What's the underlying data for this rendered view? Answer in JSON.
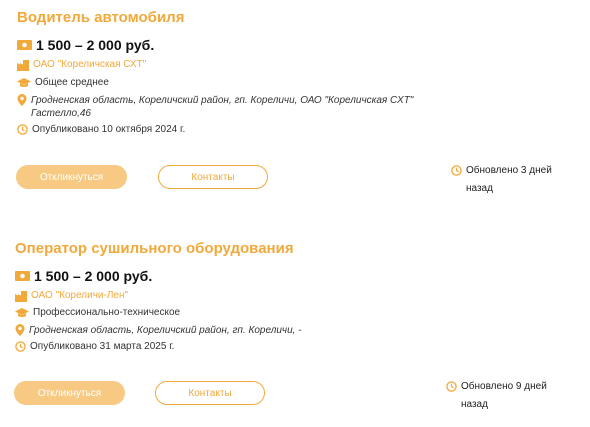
{
  "vacancies": [
    {
      "title": "Водитель автомобиля",
      "salary": "1 500 – 2 000 руб.",
      "company": "ОАО \"Кореличская СХТ\"",
      "education": "Общее среднее",
      "address_line1": "Гродненская область, Кореличский район, гп. Кореличи, ОАО \"Кореличская СХТ\"",
      "address_line2": "Гастелло,46",
      "published": "Опубликовано 10 октября 2024 г.",
      "apply_label": "Откликнуться",
      "contacts_label": "Контакты",
      "updated": "Обновлено 3 дней назад"
    },
    {
      "title": "Оператор сушильного оборудования",
      "salary": "1 500 – 2 000 руб.",
      "company": "ОАО \"Кореличи-Лен\"",
      "education": "Профессионально-техническое",
      "address_line1": "Гродненская область, Кореличский район, гп. Кореличи, -",
      "published": "Опубликовано 31 марта 2025 г.",
      "apply_label": "Откликнуться",
      "contacts_label": "Контакты",
      "updated": "Обновлено 9 дней назад"
    }
  ],
  "icons": {
    "salary": "money-icon",
    "company": "building-icon",
    "education": "graduation-cap-icon",
    "address": "location-pin-icon",
    "published": "clock-icon",
    "updated": "clock-icon"
  },
  "colors": {
    "accent": "#f2a93b",
    "button_fill": "#f7c983"
  }
}
